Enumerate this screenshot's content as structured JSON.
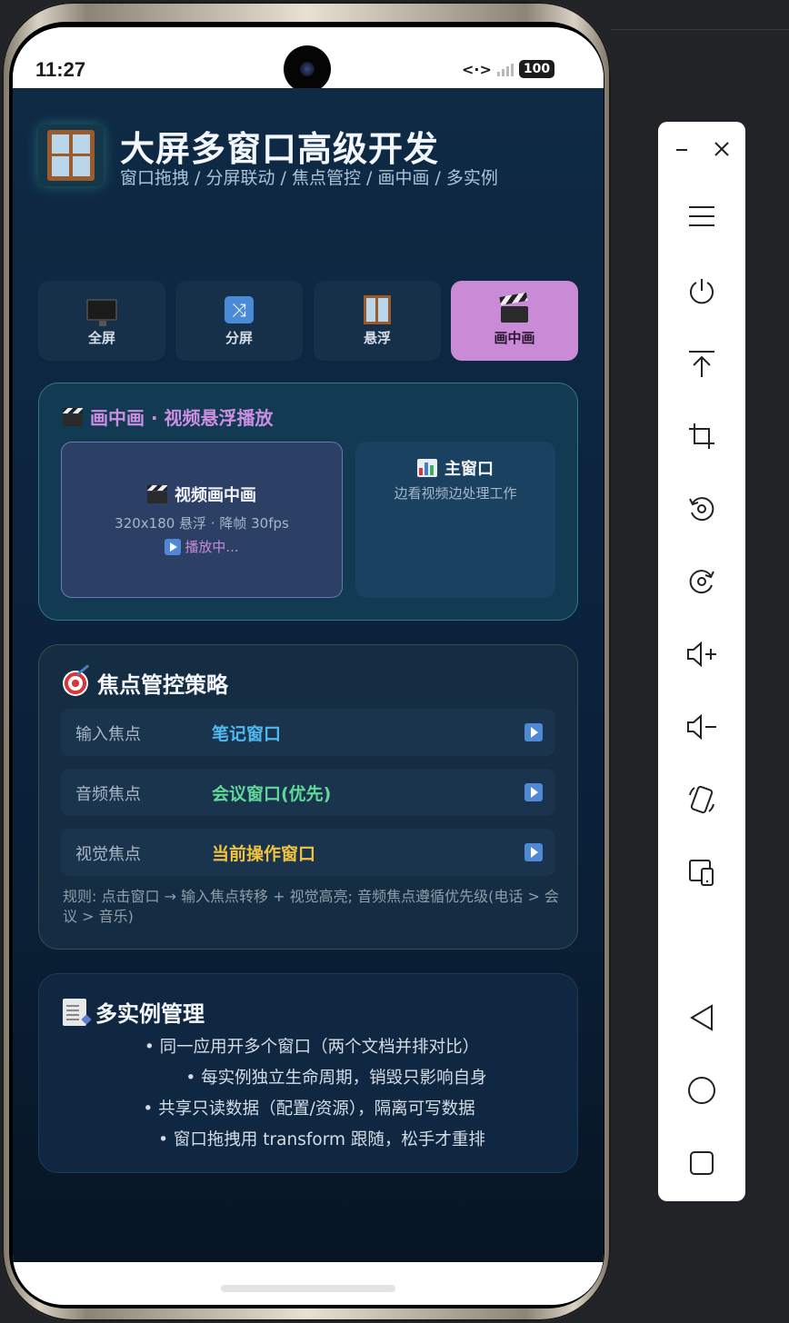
{
  "status_bar": {
    "time": "11:27",
    "battery": "100"
  },
  "header": {
    "title": "大屏多窗口高级开发",
    "subtitle": "窗口拖拽 / 分屏联动 / 焦点管控 / 画中画 / 多实例"
  },
  "tabs": [
    {
      "label": "全屏",
      "icon": "monitor-icon",
      "active": false
    },
    {
      "label": "分屏",
      "icon": "shuffle-icon",
      "active": false
    },
    {
      "label": "悬浮",
      "icon": "window-icon",
      "active": false
    },
    {
      "label": "画中画",
      "icon": "clapper-icon",
      "active": true
    }
  ],
  "pip_card": {
    "title": "画中画 · 视频悬浮播放",
    "video": {
      "title": "视频画中画",
      "meta": "320x180 悬浮 · 降帧 30fps",
      "status": "播放中..."
    },
    "main_window": {
      "title": "主窗口",
      "subtitle": "边看视频边处理工作"
    }
  },
  "focus_card": {
    "title": "焦点管控策略",
    "rows": [
      {
        "key": "输入焦点",
        "value": "笔记窗口",
        "color": "#4fb8f0"
      },
      {
        "key": "音频焦点",
        "value": "会议窗口(优先)",
        "color": "#5fd89a"
      },
      {
        "key": "视觉焦点",
        "value": "当前操作窗口",
        "color": "#f2c33e"
      }
    ],
    "rule": "规则: 点击窗口 → 输入焦点转移 + 视觉高亮; 音频焦点遵循优先级(电话 > 会议 > 音乐)"
  },
  "multi_card": {
    "title": "多实例管理",
    "items": [
      "• 同一应用开多个窗口（两个文档并排对比）",
      "• 每实例独立生命周期，销毁只影响自身",
      "• 共享只读数据（配置/资源），隔离可写数据",
      "• 窗口拖拽用 transform 跟随，松手才重排"
    ]
  },
  "colors": {
    "accent_active_tab": "#c98ad6",
    "app_background": "#0c2440"
  }
}
